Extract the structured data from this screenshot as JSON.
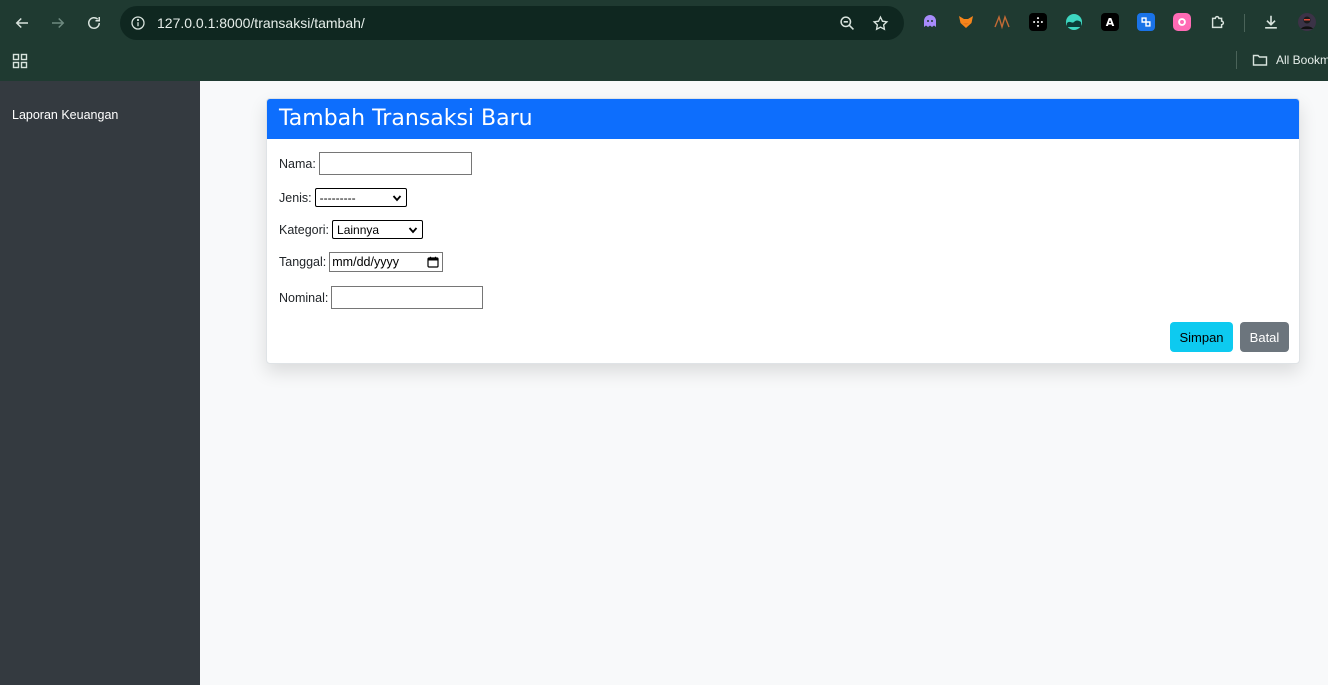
{
  "browser": {
    "url": "127.0.0.1:8000/transaksi/tambah/",
    "bookmarks_label": "All Bookm",
    "extensions": [
      "ghost-extension-icon",
      "fox-extension-icon",
      "nv-extension-icon",
      "dark-extension-icon",
      "wave-extension-icon",
      "a-extension-icon",
      "blue-extension-icon",
      "pink-extension-icon",
      "puzzle-extension-icon"
    ]
  },
  "sidebar": {
    "items": [
      {
        "label": "Laporan Keuangan"
      }
    ]
  },
  "form": {
    "title": "Tambah Transaksi Baru",
    "fields": {
      "nama": {
        "label": "Nama:",
        "value": ""
      },
      "jenis": {
        "label": "Jenis:",
        "selected": "---------"
      },
      "kategori": {
        "label": "Kategori:",
        "selected": "Lainnya"
      },
      "tanggal": {
        "label": "Tanggal:",
        "placeholder": "mm/dd/yyyy"
      },
      "nominal": {
        "label": "Nominal:",
        "value": ""
      }
    },
    "buttons": {
      "save": "Simpan",
      "cancel": "Batal"
    }
  },
  "colors": {
    "header_bg": "#0d6efd",
    "sidebar_bg": "#343a40",
    "save_bg": "#0dcaf0",
    "cancel_bg": "#6c757d"
  }
}
